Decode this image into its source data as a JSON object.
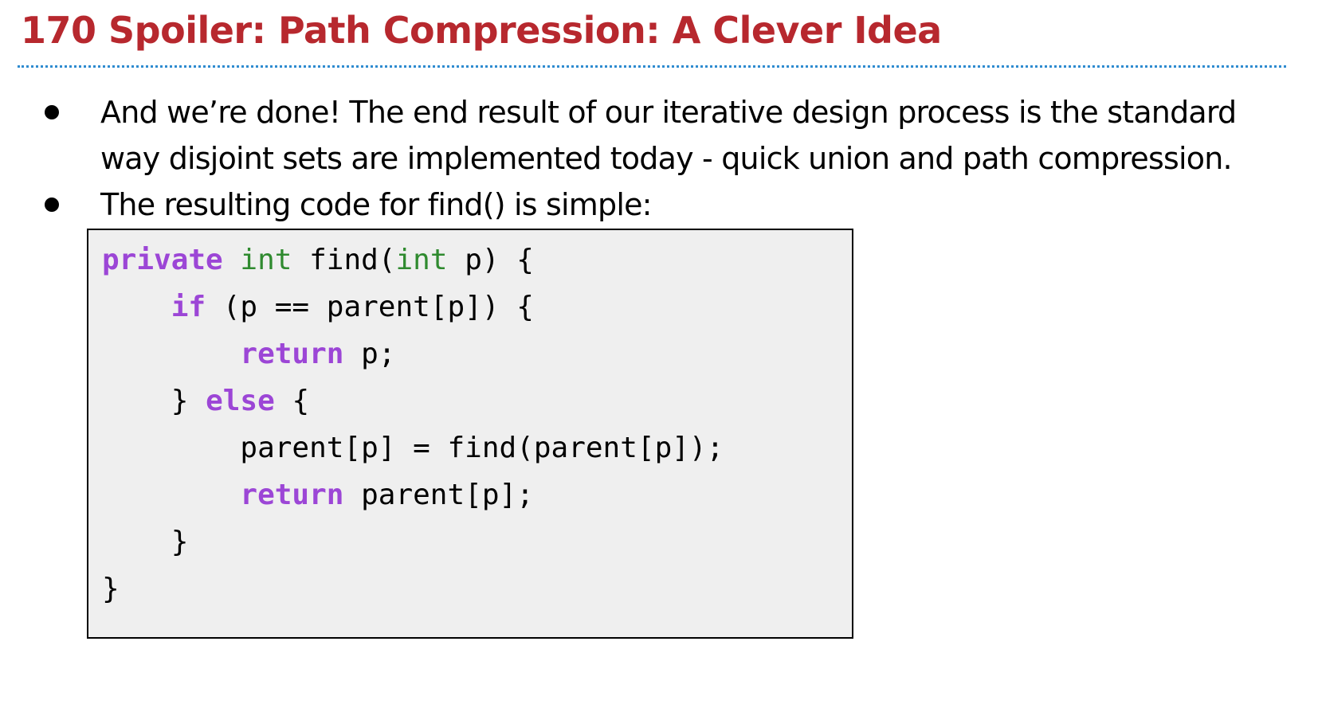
{
  "slide": {
    "title": "170 Spoiler: Path Compression: A Clever Idea"
  },
  "bullets": [
    {
      "line1": "And we’re done! The end result of our iterative design process is the standard",
      "line2": "way disjoint sets are implemented today - quick union and path compression."
    },
    {
      "line1": "The resulting code for find() is simple:"
    }
  ],
  "code": {
    "l1_kw": "private",
    "l1_ty": "int",
    "l1_a": " find(",
    "l1_ty2": "int",
    "l1_b": " p) {",
    "l2_kw": "if",
    "l2_a": " (p == parent[p]) {",
    "l3_kw": "return",
    "l3_a": " p;",
    "l4_a": "} ",
    "l4_kw": "else",
    "l4_b": " {",
    "l5_a": "parent[p] = find(parent[p]);",
    "l6_kw": "return",
    "l6_a": " parent[p];",
    "l7_a": "}",
    "l8_a": "}"
  },
  "colors": {
    "title": "#b7282e",
    "rule": "#2e8bd0",
    "keyword": "#9c46d6",
    "type": "#2f8a2f",
    "code_background": "#efefef"
  }
}
